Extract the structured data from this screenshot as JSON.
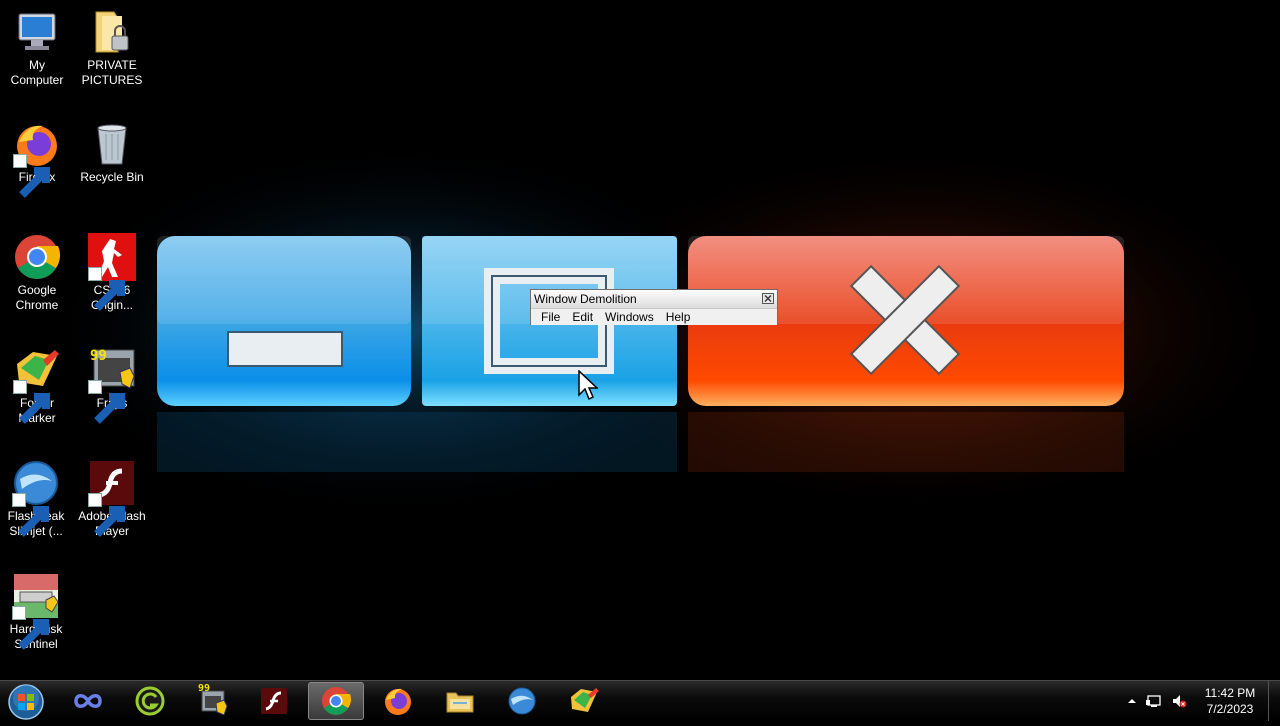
{
  "desktop": {
    "icons": [
      {
        "label_line1": "My",
        "label_line2": "Computer",
        "icon": "computer-icon"
      },
      {
        "label_line1": "PRIVATE",
        "label_line2": "PICTURES",
        "icon": "locked-folder-icon"
      },
      {
        "label_line1": "Firefox",
        "label_line2": "",
        "icon": "firefox-icon"
      },
      {
        "label_line1": "Recycle Bin",
        "label_line2": "",
        "icon": "recycle-bin-icon"
      },
      {
        "label_line1": "Google",
        "label_line2": "Chrome",
        "icon": "chrome-icon"
      },
      {
        "label_line1": "CS 1.6",
        "label_line2": "Origin...",
        "icon": "counter-strike-icon"
      },
      {
        "label_line1": "Folder",
        "label_line2": "Marker",
        "icon": "folder-marker-icon"
      },
      {
        "label_line1": "Fraps",
        "label_line2": "",
        "icon": "fraps-icon"
      },
      {
        "label_line1": "FlashPeak",
        "label_line2": "Slimjet (...",
        "icon": "slimjet-icon"
      },
      {
        "label_line1": "Adobe Flash",
        "label_line2": "Player",
        "icon": "flash-player-icon"
      },
      {
        "label_line1": "Hard Disk",
        "label_line2": "Sentinel",
        "icon": "hard-disk-sentinel-icon"
      }
    ]
  },
  "window_demolition": {
    "title": "Window Demolition",
    "menu": [
      "File",
      "Edit",
      "Windows",
      "Help"
    ]
  },
  "taskbar": {
    "pinned": [
      {
        "icon": "infinity-app-icon"
      },
      {
        "icon": "grammarly-icon"
      },
      {
        "icon": "fraps-icon"
      },
      {
        "icon": "flash-player-icon"
      },
      {
        "icon": "chrome-icon",
        "active": true
      },
      {
        "icon": "firefox-icon"
      },
      {
        "icon": "file-explorer-icon"
      },
      {
        "icon": "slimjet-icon"
      },
      {
        "icon": "folder-marker-icon"
      }
    ],
    "fraps_badge": "99",
    "clock": {
      "time": "11:42 PM",
      "date": "7/2/2023"
    }
  },
  "colors": {
    "minimize_blue": "#1ea8ff",
    "maximize_blue": "#2aa6e6",
    "close_red": "#ff3a10"
  }
}
